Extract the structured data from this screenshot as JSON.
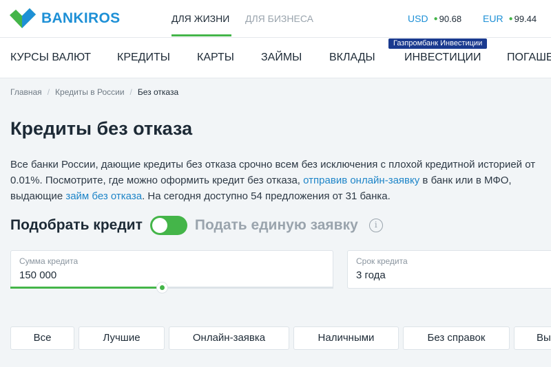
{
  "header": {
    "brand": "BANKIROS",
    "segments": [
      "Для жизни",
      "Для бизнеса"
    ],
    "rates": [
      {
        "code": "USD",
        "value": "90.68"
      },
      {
        "code": "EUR",
        "value": "99.44"
      }
    ]
  },
  "nav": {
    "items": [
      "Курсы валют",
      "Кредиты",
      "Карты",
      "Займы",
      "Вклады",
      "Инвестиции",
      "Погаше"
    ],
    "badge": "Газпромбанк Инвестиции"
  },
  "breadcrumb": [
    "Главная",
    "Кредиты в России",
    "Без отказа"
  ],
  "page": {
    "title": "Кредиты без отказа",
    "desc_part1": "Все банки России, дающие кредиты без отказа срочно всем без исключения с плохой кредитной историей от 0.01%. Посмотрите, где можно оформить кредит без отказа, ",
    "desc_link1": "отправив онлайн-заявку",
    "desc_part2": " в банк или в МФО, выдающие ",
    "desc_link2": "займ без отказа",
    "desc_part3": ". На сегодня доступно 54 предложения от 31 банка."
  },
  "picker": {
    "label": "Подобрать кредит",
    "alt_label": "Подать единую заявку",
    "info_glyph": "i"
  },
  "form": {
    "sum_label": "Сумма кредита",
    "sum_value": "150 000",
    "sum_slider_fraction": 0.47,
    "term_label": "Срок кредита",
    "term_value": "3 года"
  },
  "filters": [
    "Все",
    "Лучшие",
    "Онлайн-заявка",
    "Наличными",
    "Без справок",
    "Вы"
  ],
  "colors": {
    "brand_blue": "#1e90d6",
    "accent_green": "#44b549",
    "badge_navy": "#1a3a8f"
  }
}
